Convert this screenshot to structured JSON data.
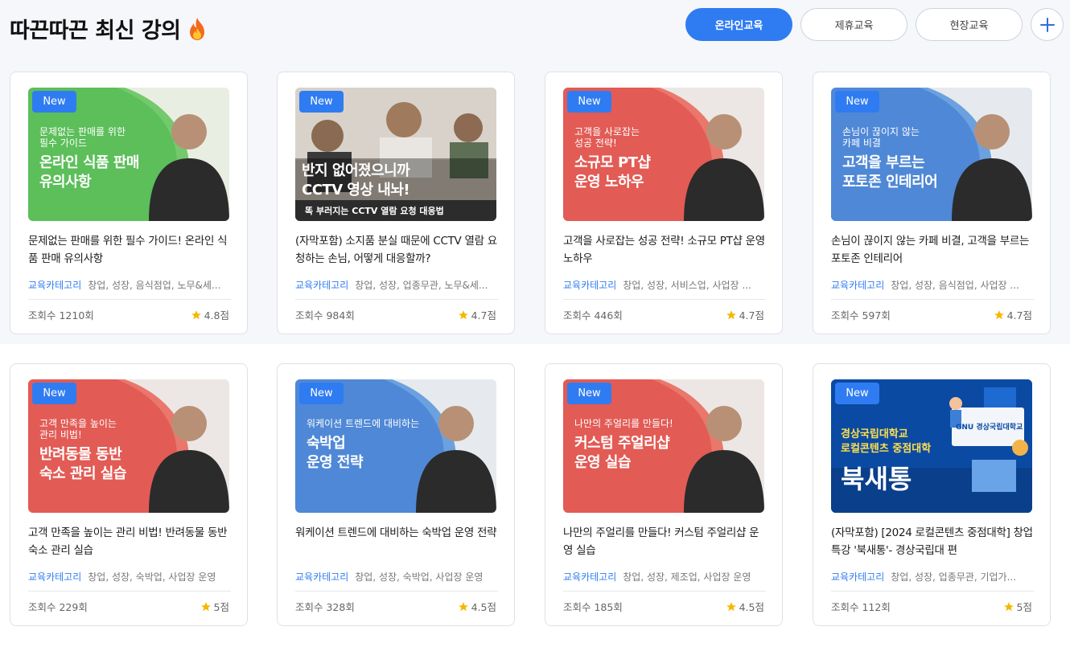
{
  "header": {
    "title": "따끈따끈 최신 강의",
    "flame_icon": "flame-icon",
    "filters": [
      {
        "label": "온라인교육",
        "active": true
      },
      {
        "label": "제휴교육",
        "active": false
      },
      {
        "label": "현장교육",
        "active": false
      }
    ],
    "plus_icon": "plus-icon"
  },
  "colors": {
    "accent": "#2f7cf2",
    "star": "#f5b800",
    "band": "#f5f7fb"
  },
  "cards": [
    {
      "badge": "New",
      "thumb_sub": "문제없는 판매를 위한\n필수 가이드",
      "thumb_main": "온라인 식품 판매\n유의사항",
      "thumb_color": "green",
      "title": "문제없는 판매를 위한 필수 가이드! 온라인 식품 판매 유의사항",
      "category": "교육카테고리",
      "tags": "창업, 성장, 음식점업, 노무&세...",
      "views": "조회수 1210회",
      "rating": "4.8점"
    },
    {
      "badge": "New",
      "thumb_sub": "",
      "thumb_main": "반지 없어졌으니까\nCCTV 영상 내놔!",
      "thumb_footer": "똑 부러지는 CCTV 열람 요청 대응법",
      "thumb_color": "photo",
      "title": "(자막포함) 소지품 분실 때문에 CCTV 열람 요청하는 손님, 어떻게 대응할까?",
      "category": "교육카테고리",
      "tags": "창업, 성장, 업종무관, 노무&세...",
      "views": "조회수 984회",
      "rating": "4.7점"
    },
    {
      "badge": "New",
      "thumb_sub": "고객을 사로잡는\n성공 전략!",
      "thumb_main": "소규모 PT샵\n운영 노하우",
      "thumb_color": "red",
      "title": "고객을 사로잡는 성공 전략! 소규모 PT샵 운영 노하우",
      "category": "교육카테고리",
      "tags": "창업, 성장, 서비스업, 사업장 ...",
      "views": "조회수 446회",
      "rating": "4.7점"
    },
    {
      "badge": "New",
      "thumb_sub": "손님이 끊이지 않는\n카페 비결",
      "thumb_main": "고객을 부르는\n포토존 인테리어",
      "thumb_color": "blue",
      "title": "손님이 끊이지 않는 카페 비결, 고객을 부르는 포토존 인테리어",
      "category": "교육카테고리",
      "tags": "창업, 성장, 음식점업, 사업장 ...",
      "views": "조회수 597회",
      "rating": "4.7점"
    },
    {
      "badge": "New",
      "thumb_sub": "고객 만족을 높이는\n관리 비법!",
      "thumb_main": "반려동물 동반\n숙소 관리 실습",
      "thumb_color": "red",
      "title": "고객 만족을 높이는 관리 비법! 반려동물 동반 숙소 관리 실습",
      "category": "교육카테고리",
      "tags": "창업, 성장, 숙박업, 사업장 운영",
      "views": "조회수 229회",
      "rating": "5점"
    },
    {
      "badge": "New",
      "thumb_sub": "워케이션 트렌드에 대비하는",
      "thumb_main": "숙박업\n운영 전략",
      "thumb_color": "blue",
      "title": "워케이션 트렌드에 대비하는 숙박업 운영 전략",
      "category": "교육카테고리",
      "tags": "창업, 성장, 숙박업, 사업장 운영",
      "views": "조회수 328회",
      "rating": "4.5점"
    },
    {
      "badge": "New",
      "thumb_sub": "나만의 주얼리를 만들다!",
      "thumb_main": "커스텀 주얼리샵\n운영 실습",
      "thumb_color": "red",
      "title": "나만의 주얼리를 만들다! 커스텀 주얼리샵 운영 실습",
      "category": "교육카테고리",
      "tags": "창업, 성장, 제조업, 사업장 운영",
      "views": "조회수 185회",
      "rating": "4.5점"
    },
    {
      "badge": "New",
      "thumb_sub": "경상국립대학교\n로컬콘텐츠 중점대학",
      "thumb_main": "북새통",
      "thumb_logo": "GNU 경상국립대학교",
      "thumb_color": "navy",
      "title": "(자막포함) [2024 로컬콘텐츠 중점대학] 창업특강 '북새통'- 경상국립대 편",
      "category": "교육카테고리",
      "tags": "창업, 성장, 업종무관, 기업가...",
      "views": "조회수 112회",
      "rating": "5점"
    }
  ]
}
